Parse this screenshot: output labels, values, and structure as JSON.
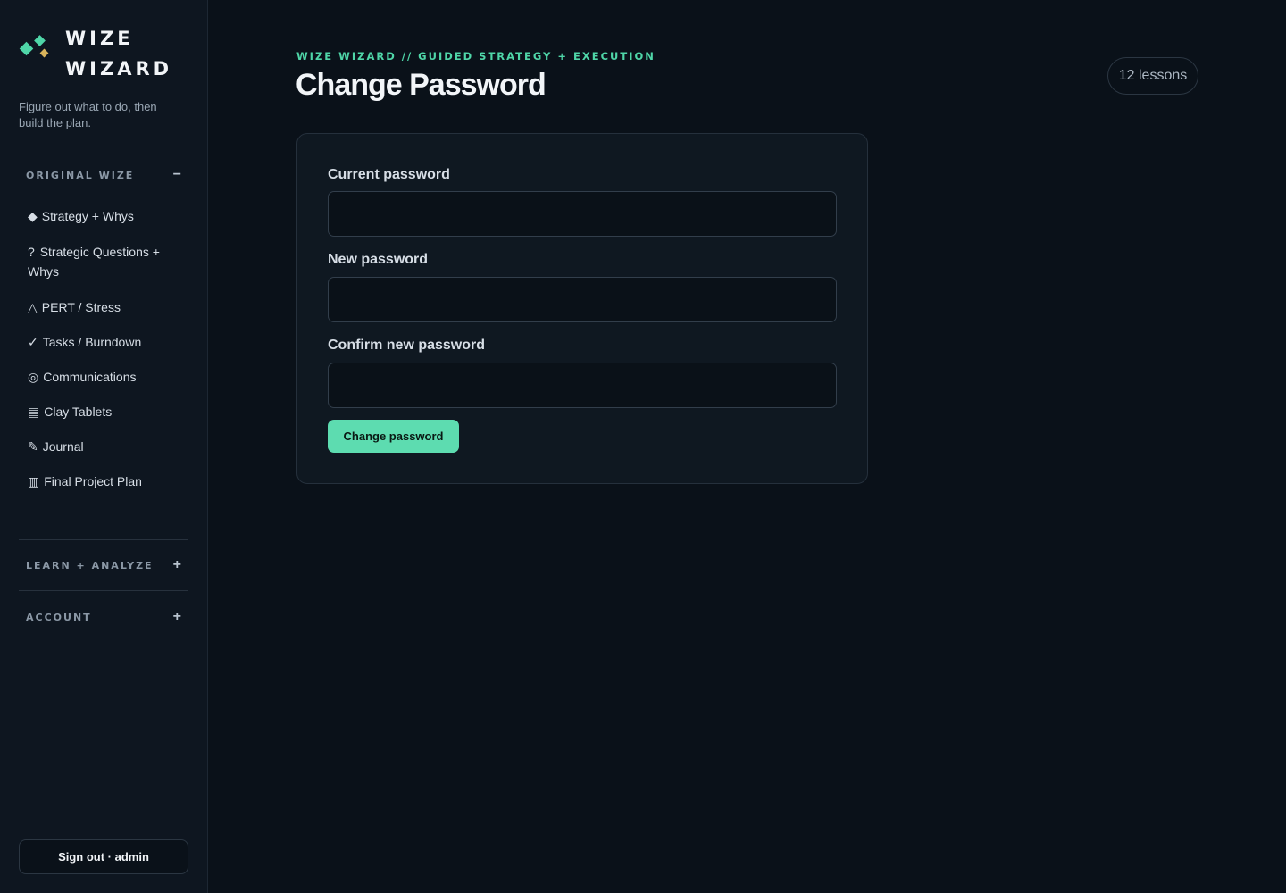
{
  "sidebar": {
    "logo": {
      "line1": "WIZE",
      "line2": "WIZARD"
    },
    "tagline": "Figure out what to do, then build the plan.",
    "sections": [
      {
        "label": "ORIGINAL WIZE",
        "toggle": "−",
        "expanded": true,
        "items": [
          {
            "glyph": "◆",
            "label": "Strategy + Whys"
          },
          {
            "glyph": "?",
            "label": "Strategic Questions + Whys"
          },
          {
            "glyph": "△",
            "label": "PERT / Stress"
          },
          {
            "glyph": "✓",
            "label": "Tasks / Burndown"
          },
          {
            "glyph": "◎",
            "label": "Communications"
          },
          {
            "glyph": "▤",
            "label": "Clay Tablets"
          },
          {
            "glyph": "✎",
            "label": "Journal"
          },
          {
            "glyph": "▥",
            "label": "Final Project Plan"
          }
        ]
      },
      {
        "label": "LEARN + ANALYZE",
        "toggle": "+",
        "expanded": false
      },
      {
        "label": "ACCOUNT",
        "toggle": "+",
        "expanded": false
      }
    ],
    "signout_label": "Sign out · admin"
  },
  "header": {
    "eyebrow": "WIZE WIZARD // GUIDED STRATEGY + EXECUTION",
    "title": "Change Password",
    "lessons_badge": "12 lessons"
  },
  "form": {
    "fields": [
      {
        "label": "Current password",
        "value": ""
      },
      {
        "label": "New password",
        "value": ""
      },
      {
        "label": "Confirm new password",
        "value": ""
      }
    ],
    "submit_label": "Change password"
  },
  "colors": {
    "accent": "#4fd6a8",
    "accent_gold": "#d9b45c",
    "background": "#0a1119",
    "sidebar_bg": "#0e1620",
    "card_bg": "#0f1821"
  }
}
